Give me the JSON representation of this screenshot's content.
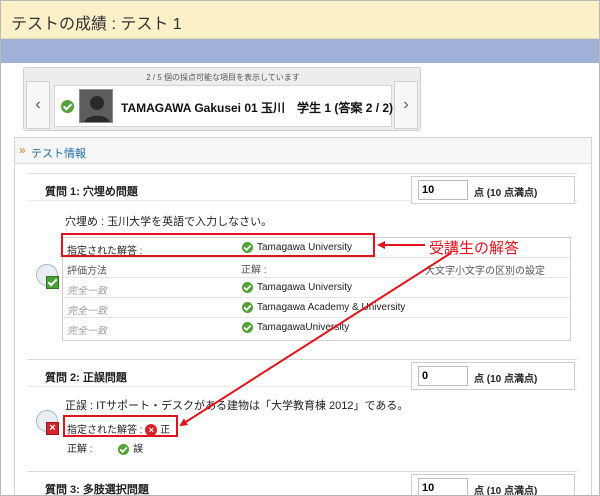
{
  "page": {
    "title": "テストの成績 : テスト 1"
  },
  "navigator": {
    "count_text": "2 / 5 個の採点可能な項目を表示しています",
    "student_name": "TAMAGAWA Gakusei 01 玉川　学生 1 (答案 2 / 2)",
    "prev_icon": "chevron-left-icon",
    "next_icon": "chevron-right-icon"
  },
  "section": {
    "label": "テスト情報"
  },
  "questions": [
    {
      "title": "質問 1:  穴埋め問題",
      "score": "10",
      "points_label": "点 (10 点満点)",
      "prompt": "穴埋め : 玉川大学を英語で入力しなさい。",
      "given_answer_label": "指定された解答 :",
      "given_answer": "Tamagawa University",
      "table_headers": [
        "評価方法",
        "正解 :",
        "大文字小文字の区別の設定"
      ],
      "rows": [
        {
          "method": "完全一致",
          "answer": "Tamagawa University"
        },
        {
          "method": "完全一致",
          "answer": "Tamagawa Academy & University"
        },
        {
          "method": "完全一致",
          "answer": "TamagawaUniversity"
        }
      ]
    },
    {
      "title": "質問 2:  正誤問題",
      "score": "0",
      "points_label": "点 (10 点満点)",
      "prompt": "正誤 : ITサポート・デスクがある建物は「大学教育棟 2012」である。",
      "given_answer_label": "指定された解答 :",
      "given_answer": "正",
      "correct_label": "正解 :",
      "correct_answer": "誤"
    },
    {
      "title": "質問 3:  多肢選択問題",
      "score": "10",
      "points_label": "点 (10 点満点)"
    }
  ],
  "annotation": {
    "label": "受講生の解答"
  },
  "colors": {
    "accent_red": "#e0141e",
    "correct_green": "#54a03b",
    "header_yellow": "#fbf0c8",
    "band_blue": "#9fb1d6",
    "link_blue": "#1f6fa8"
  }
}
